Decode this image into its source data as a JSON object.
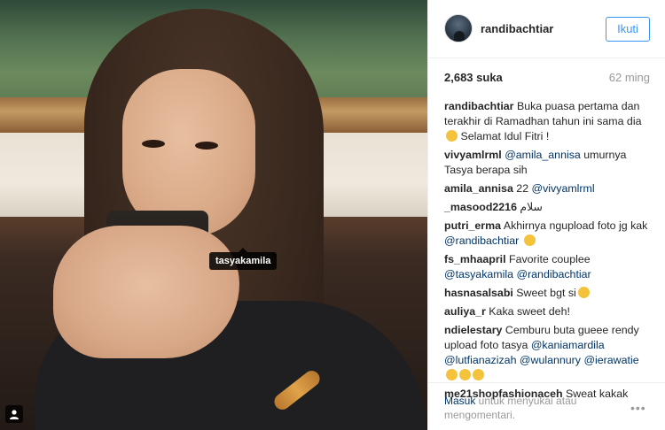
{
  "photo": {
    "tag_label": "tasyakamila",
    "user_icon": "person-icon"
  },
  "post": {
    "username": "randibachtiar",
    "follow_label": "Ikuti",
    "likes": "2,683 suka",
    "time_ago": "62 ming"
  },
  "comments": [
    {
      "user": "randibachtiar",
      "parts": [
        {
          "t": "Buka puasa pertama dan terakhir di Ramadhan tahun ini sama dia "
        },
        {
          "emoji": "wink"
        },
        {
          "t": " Selamat Idul Fitri !"
        }
      ]
    },
    {
      "user": "vivyamlrml",
      "parts": [
        {
          "m": "@amila_annisa"
        },
        {
          "t": " umurnya Tasya berapa sih"
        }
      ]
    },
    {
      "user": "amila_annisa",
      "parts": [
        {
          "t": "22 "
        },
        {
          "m": "@vivyamlrml"
        }
      ]
    },
    {
      "user": "_masood2216",
      "parts": [
        {
          "t": "سلام"
        }
      ]
    },
    {
      "user": "putri_erma",
      "parts": [
        {
          "t": "Akhirnya ngupload foto jg kak "
        },
        {
          "m": "@randibachtiar"
        },
        {
          "t": " "
        },
        {
          "emoji": "cry"
        }
      ]
    },
    {
      "user": "fs_mhaapril",
      "parts": [
        {
          "t": "Favorite couplee "
        },
        {
          "m": "@tasyakamila"
        },
        {
          "t": " "
        },
        {
          "m": "@randibachtiar"
        }
      ]
    },
    {
      "user": "hasnasalsabi",
      "parts": [
        {
          "t": "Sweet bgt si"
        },
        {
          "emoji": "heart-eyes"
        }
      ]
    },
    {
      "user": "auliya_r",
      "parts": [
        {
          "t": "Kaka sweet deh!"
        }
      ]
    },
    {
      "user": "ndielestary",
      "parts": [
        {
          "t": "Cemburu buta gueee rendy upload foto tasya "
        },
        {
          "m": "@kaniamardila"
        },
        {
          "t": " "
        },
        {
          "m": "@lutfianazizah"
        },
        {
          "t": " "
        },
        {
          "m": "@wulannury"
        },
        {
          "t": " "
        },
        {
          "m": "@ierawatie"
        },
        {
          "t": " "
        },
        {
          "emoji": "cry"
        },
        {
          "emoji": "sweat"
        },
        {
          "emoji": "cry"
        }
      ]
    },
    {
      "user": "me21shopfashionaceh",
      "parts": [
        {
          "t": "Sweat kakak"
        }
      ]
    }
  ],
  "footer": {
    "login_link": "Masuk",
    "login_text": " untuk menyukai atau mengomentari.",
    "more_label": "•••"
  },
  "colors": {
    "link": "#003569",
    "follow": "#3897f0",
    "muted": "#999999"
  }
}
